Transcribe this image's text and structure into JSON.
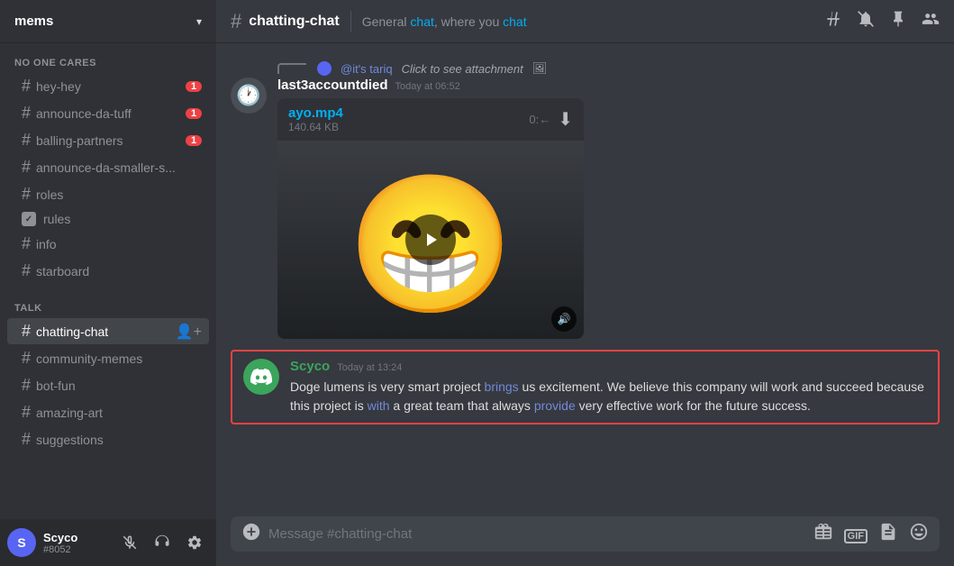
{
  "server": {
    "name": "mems",
    "arrow": "▾"
  },
  "sidebar": {
    "sections": [
      {
        "label": "NO ONE CARES",
        "channels": [
          {
            "id": "hey-hey",
            "name": "hey-hey",
            "type": "hash",
            "badge": "1"
          },
          {
            "id": "announce-da-tuff",
            "name": "announce-da-tuff",
            "type": "hash",
            "badge": "1"
          },
          {
            "id": "balling-partners",
            "name": "balling-partners",
            "type": "hash",
            "badge": "1"
          },
          {
            "id": "announce-da-smaller-s",
            "name": "announce-da-smaller-s...",
            "type": "hash",
            "badge": ""
          },
          {
            "id": "roles",
            "name": "roles",
            "type": "hash",
            "badge": ""
          },
          {
            "id": "rules",
            "name": "rules",
            "type": "checkbox",
            "badge": ""
          },
          {
            "id": "info",
            "name": "info",
            "type": "hash",
            "badge": ""
          },
          {
            "id": "starboard",
            "name": "starboard",
            "type": "hash",
            "badge": ""
          }
        ]
      },
      {
        "label": "TALK",
        "channels": [
          {
            "id": "chatting-chat",
            "name": "chatting-chat",
            "type": "hash",
            "badge": "",
            "active": true,
            "add": true
          },
          {
            "id": "community-memes",
            "name": "community-memes",
            "type": "hash",
            "badge": ""
          },
          {
            "id": "bot-fun",
            "name": "bot-fun",
            "type": "hash",
            "badge": ""
          },
          {
            "id": "amazing-art",
            "name": "amazing-art",
            "type": "hash",
            "badge": ""
          },
          {
            "id": "suggestions",
            "name": "suggestions",
            "type": "hash",
            "badge": ""
          }
        ]
      }
    ]
  },
  "channel": {
    "name": "chatting-chat",
    "topic": "General chat, where you chat",
    "topic_parts": {
      "before": "General ",
      "highlight": "chat",
      "middle": ", where you ",
      "highlight2": "chat"
    }
  },
  "messages": [
    {
      "id": "msg1",
      "type": "video",
      "reply_mention": "@it's tariq",
      "reply_text": "Click to see attachment",
      "username": "last3accountdied",
      "timestamp": "Today at 06:52",
      "avatar_emoji": "🕐",
      "attachment": {
        "filename": "ayo.mp4",
        "duration": "0:←",
        "filesize": "140.64 KB",
        "emoji": "😁"
      }
    },
    {
      "id": "msg2",
      "type": "highlighted",
      "username": "Scyco",
      "timestamp": "Today at 13:24",
      "text": "Doge lumens is very smart project brings us excitement. We believe this company will work and succeed because this project is with a great team that always provide very effective work for the future success.",
      "avatar_type": "discord-icon"
    }
  ],
  "input": {
    "placeholder": "Message #chatting-chat"
  },
  "user": {
    "name": "Scyco",
    "tag": "#8052",
    "initials": "S"
  },
  "icons": {
    "hash": "#",
    "mute_bell": "🔕",
    "pin": "📌",
    "member": "👤",
    "plus": "+",
    "gift": "🎁",
    "gif": "GIF",
    "file": "📄",
    "emoji": "😊",
    "mute_mic": "🎤",
    "headphone": "🎧",
    "settings": "⚙"
  }
}
